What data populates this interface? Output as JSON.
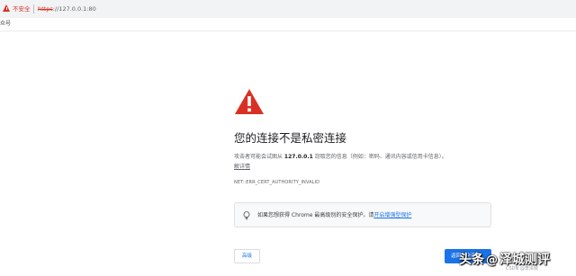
{
  "browser": {
    "security_label": "不安全",
    "url_scheme": "https",
    "url_rest": "://127.0.0.1:80"
  },
  "bookmarks": {
    "item_1": "众号"
  },
  "interstitial": {
    "title": "您的连接不是私密连接",
    "desc_prefix": "攻击者可能会试图从 ",
    "desc_host": "127.0.0.1",
    "desc_suffix": " 窃取您的信息（例如：密码、通讯内容或信用卡信息）。",
    "details_link": "解详情",
    "error_code": "NET::ERR_CERT_AUTHORITY_INVALID",
    "enhanced_text": "如果您想获得 Chrome 最高级别的安全保护，请",
    "enhanced_link": "开启增强型保护",
    "advanced_button": "高级",
    "back_button": "返回安全连接"
  },
  "watermark": {
    "text_1": "头条",
    "hand": "@",
    "text_2": "泽城测评",
    "sub": "CSDN @李泽城"
  },
  "colors": {
    "danger": "#d93025",
    "link": "#1a73e8",
    "primary_button": "#1a73e8"
  },
  "icons": {
    "security": "warning-triangle-icon",
    "danger": "danger-triangle-icon",
    "tip": "lightbulb-icon"
  }
}
